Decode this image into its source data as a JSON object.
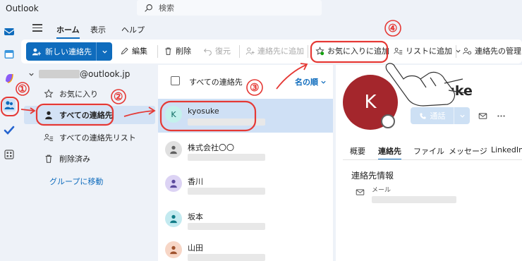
{
  "app": {
    "title": "Outlook"
  },
  "search": {
    "placeholder": "検索"
  },
  "menu": {
    "tabs": [
      "ホーム",
      "表示",
      "ヘルプ"
    ]
  },
  "toolbar": {
    "new_contact": "新しい連絡先",
    "edit": "編集",
    "delete": "削除",
    "restore": "復元",
    "add_to_contacts": "連絡先に追加",
    "add_to_favorites": "お気に入りに追加",
    "add_to_list": "リストに追加",
    "manage_contacts": "連絡先の管理"
  },
  "folders": {
    "account": "@outlook.jp",
    "items": [
      "お気に入り",
      "すべての連絡先",
      "すべての連絡先リスト",
      "削除済み"
    ],
    "group_link": "グループに移動"
  },
  "list": {
    "header_label": "すべての連絡先",
    "sort_label": "名の順",
    "contacts": [
      {
        "name": "kyosuke",
        "initial": "K"
      },
      {
        "name": "株式会社〇〇",
        "initial": ""
      },
      {
        "name": "香川",
        "initial": ""
      },
      {
        "name": "坂本",
        "initial": ""
      },
      {
        "name": "山田",
        "initial": ""
      }
    ]
  },
  "detail": {
    "initial": "K",
    "name": "kyosuke",
    "call_label": "通話",
    "tabs": [
      "概要",
      "連絡先",
      "ファイル",
      "メッセージ",
      "LinkedIn"
    ],
    "section_title": "連絡先情報",
    "mail_label": "メール"
  },
  "annotations": [
    "①",
    "②",
    "③",
    "④"
  ],
  "colors": {
    "accent": "#0f6cbd",
    "annotation": "#e53935",
    "avatar_bg": "#a4262c"
  }
}
